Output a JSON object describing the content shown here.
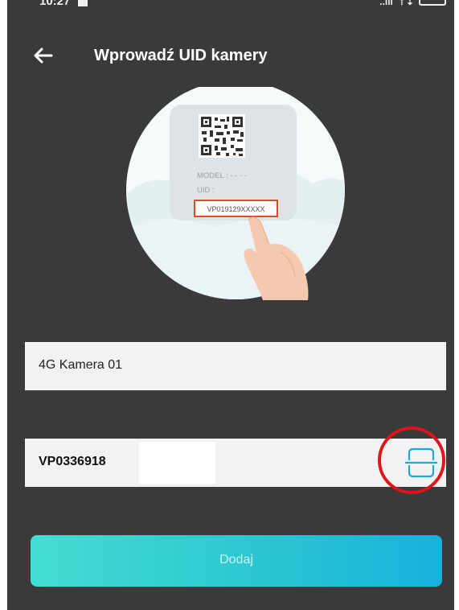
{
  "status_bar": {
    "time": "10:27",
    "signal": "..ıll",
    "wifi": "⇡⇣"
  },
  "header": {
    "title": "Wprowadź UID kamery"
  },
  "illustration": {
    "model_label": "MODEL : - - - -",
    "uid_label": "UID :",
    "uid_example": "VP019129XXXXX"
  },
  "form": {
    "device_name": {
      "value": "4G Kamera 01"
    },
    "uid": {
      "value": "VP0336918"
    }
  },
  "actions": {
    "add_label": "Dodaj"
  },
  "colors": {
    "background": "#3a3a3a",
    "field": "#f2f2f2",
    "accent_start": "#43ded3",
    "accent_end": "#16b2de",
    "highlight": "#e0141d",
    "scan_icon": "#1ea8d8"
  }
}
